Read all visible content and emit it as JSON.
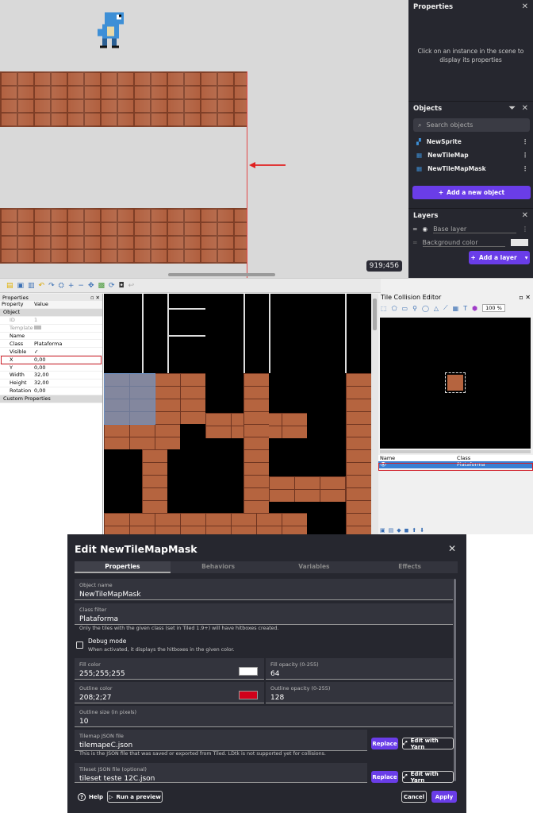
{
  "scene": {
    "coord": "919;456"
  },
  "properties_panel": {
    "title": "Properties",
    "hint": "Click on an instance in the scene to display its properties"
  },
  "objects_panel": {
    "title": "Objects",
    "search_placeholder": "Search objects",
    "items": [
      {
        "name": "NewSprite"
      },
      {
        "name": "NewTileMap"
      },
      {
        "name": "NewTileMapMask"
      }
    ],
    "add_label": "Add a new object"
  },
  "layers_panel": {
    "title": "Layers",
    "base_layer": "Base layer",
    "background": "Background color",
    "add_label": "Add a layer"
  },
  "tiled": {
    "props_title": "Properties",
    "col_property": "Property",
    "col_value": "Value",
    "group_object": "Object",
    "rows": [
      {
        "k": "ID",
        "v": "1"
      },
      {
        "k": "Template",
        "v": ""
      },
      {
        "k": "Name",
        "v": ""
      },
      {
        "k": "Class",
        "v": "Plataforma"
      },
      {
        "k": "Visible",
        "v": "✓"
      },
      {
        "k": "X",
        "v": "0,00"
      },
      {
        "k": "Y",
        "v": "0,00"
      },
      {
        "k": "Width",
        "v": "32,00"
      },
      {
        "k": "Height",
        "v": "32,00"
      },
      {
        "k": "Rotation",
        "v": "0,00"
      }
    ],
    "group_custom": "Custom Properties",
    "collision_title": "Tile Collision Editor",
    "zoom": "100 %",
    "col_name": "Name",
    "col_class": "Class",
    "row_class": "Plataforma"
  },
  "dialog": {
    "title": "Edit NewTileMapMask",
    "tabs": [
      "Properties",
      "Behaviors",
      "Variables",
      "Effects"
    ],
    "object_name_label": "Object name",
    "object_name": "NewTileMapMask",
    "class_filter_label": "Class filter",
    "class_filter": "Plataforma",
    "class_filter_help": "Only the tiles with the given class (set in Tiled 1.9+) will have hitboxes created.",
    "debug_label": "Debug mode",
    "debug_help": "When activated, it displays the hitboxes in the given color.",
    "fill_color_label": "Fill color",
    "fill_color": "255;255;255",
    "fill_opacity_label": "Fill opacity (0-255)",
    "fill_opacity": "64",
    "outline_color_label": "Outline color",
    "outline_color": "208;2;27",
    "outline_opacity_label": "Outline opacity (0-255)",
    "outline_opacity": "128",
    "outline_size_label": "Outline size (in pixels)",
    "outline_size": "10",
    "tilemap_label": "Tilemap JSON file",
    "tilemap_value": "tilemapeC.json",
    "tilemap_help": "This is the JSON file that was saved or exported from Tiled. LDtk is not supported yet for collisions.",
    "tileset_label": "Tileset JSON file (optional)",
    "tileset_value": "tileset teste 12C.json",
    "replace_label": "Replace",
    "edit_yarn_label": "Edit with Yarn",
    "help_label": "Help",
    "preview_label": "Run a preview",
    "cancel_label": "Cancel",
    "apply_label": "Apply"
  },
  "colors": {
    "accent": "#6a3de8",
    "outline_red": "#d0021b",
    "panel": "#26272f"
  }
}
